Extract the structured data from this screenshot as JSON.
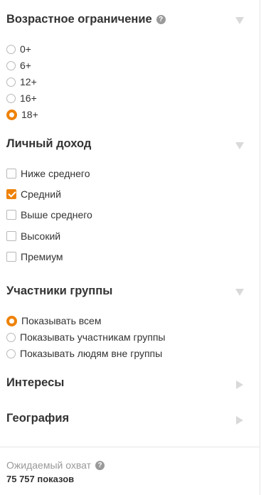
{
  "age": {
    "title": "Возрастное ограничение",
    "help_icon": "question-circle-icon",
    "options": [
      "0+",
      "6+",
      "12+",
      "16+",
      "18+"
    ],
    "selected": "18+"
  },
  "income": {
    "title": "Личный доход",
    "options": [
      "Ниже среднего",
      "Средний",
      "Выше среднего",
      "Высокий",
      "Премиум"
    ],
    "checked": [
      "Средний"
    ]
  },
  "members": {
    "title": "Участники группы",
    "options": [
      "Показывать всем",
      "Показывать участникам группы",
      "Показывать людям вне группы"
    ],
    "selected": "Показывать всем"
  },
  "interests": {
    "title": "Интересы"
  },
  "geography": {
    "title": "География"
  },
  "reach": {
    "label": "Ожидаемый охват",
    "help_icon": "question-circle-icon",
    "value": "75 757 показов"
  },
  "colors": {
    "accent": "#ee8208",
    "text": "#333333",
    "muted": "#999999",
    "chevron": "#d9d9d9"
  }
}
